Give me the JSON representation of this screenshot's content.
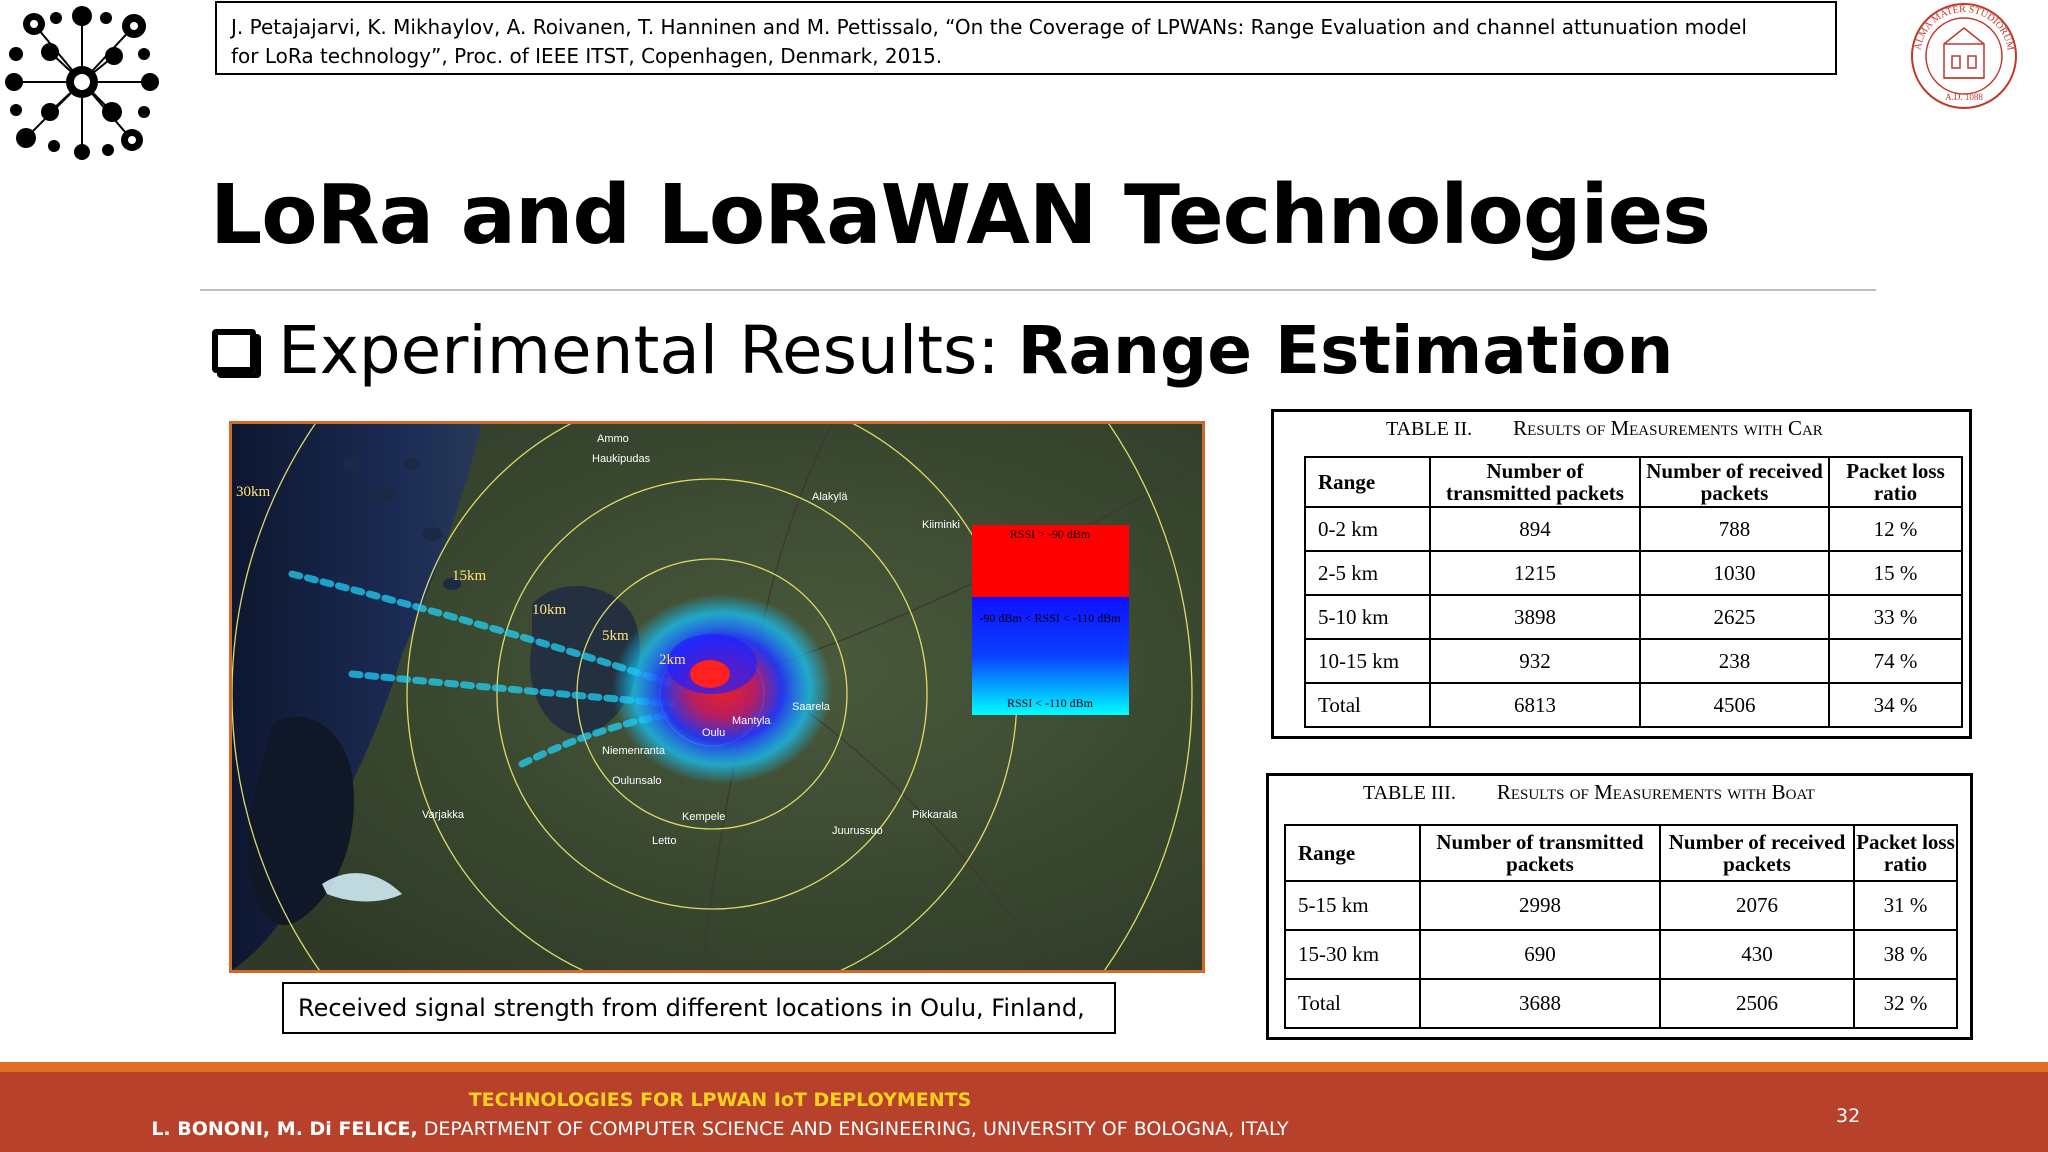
{
  "citation": {
    "line1": "J. Petajajarvi, K. Mikhaylov, A. Roivanen, T. Hanninen and M. Pettissalo, “On the Coverage of LPWANs: Range Evaluation and channel attunuation model",
    "line2": "for LoRa technology”, Proc. of IEEE ITST, Copenhagen, Denmark, 2015."
  },
  "title": "LoRa and LoRaWAN Technologies",
  "bullet": {
    "text": "Experimental Results: ",
    "bold": "Range Estimation"
  },
  "map": {
    "ring_labels": [
      "30km",
      "15km",
      "10km",
      "5km",
      "2km"
    ],
    "towns": [
      "Ammo",
      "Haukipudas",
      "Alakylä",
      "Kiiminki",
      "Oulu",
      "Saarela",
      "Mantyla",
      "Niemenranta",
      "Oulunsalo",
      "Kempele",
      "Varjakka",
      "Pikkarala",
      "Juurussuo",
      "Letto"
    ],
    "legend": {
      "high": "RSSI > -90 dBm",
      "mid": "-90 dBm < RSSI < -110 dBm",
      "low": "RSSI < -110 dBm",
      "colors": {
        "high": "#ff0000",
        "mid": "#1a1aff",
        "low": "#00ffff"
      }
    }
  },
  "caption": "Received signal strength from different locations in Oulu, Finland,",
  "table2": {
    "caption_number": "TABLE II.",
    "caption_title": "Results of Measurements with Car",
    "headers": [
      "Range",
      "Number of transmitted packets",
      "Number of received packets",
      "Packet loss ratio"
    ],
    "rows": [
      [
        "0-2 km",
        "894",
        "788",
        "12 %"
      ],
      [
        "2-5 km",
        "1215",
        "1030",
        "15 %"
      ],
      [
        "5-10 km",
        "3898",
        "2625",
        "33 %"
      ],
      [
        "10-15 km",
        "932",
        "238",
        "74 %"
      ],
      [
        "Total",
        "6813",
        "4506",
        "34 %"
      ]
    ]
  },
  "table3": {
    "caption_number": "TABLE III.",
    "caption_title": "Results of Measurements with Boat",
    "headers": [
      "Range",
      "Number of transmitted packets",
      "Number of received packets",
      "Packet loss ratio"
    ],
    "rows": [
      [
        "5-15 km",
        "2998",
        "2076",
        "31 %"
      ],
      [
        "15-30 km",
        "690",
        "430",
        "38 %"
      ],
      [
        "Total",
        "3688",
        "2506",
        "32 %"
      ]
    ]
  },
  "footer": {
    "title": "TECHNOLOGIES FOR LPWAN IoT DEPLOYMENTS",
    "authors": "L. BONONI, M. Di FELICE,",
    "dept": "DEPARTMENT OF COMPUTER SCIENCE AND ENGINEERING, UNIVERSITY OF BOLOGNA, ITALY",
    "page": "32"
  },
  "seal_text": "ALMA MATER STUDIORUM · A.D. 1088",
  "colors": {
    "footer_bg": "#b7412b",
    "footer_strip": "#e06f22",
    "footer_title": "#ffd21f",
    "map_border": "#d06a2a",
    "seal": "#c0392b"
  }
}
